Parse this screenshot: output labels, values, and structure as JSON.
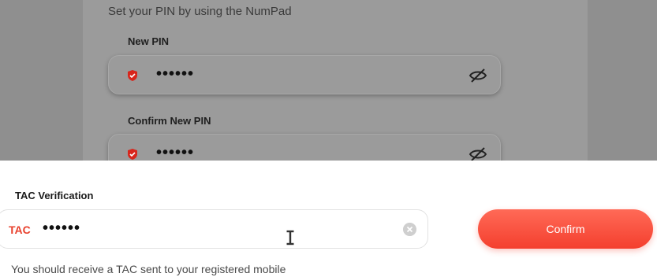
{
  "background": {
    "hint": "Set your PIN by using the NumPad",
    "new_pin": {
      "label": "New PIN",
      "value": "••••••"
    },
    "confirm_pin": {
      "label": "Confirm New PIN",
      "value": "••••••"
    }
  },
  "sheet": {
    "title": "TAC Verification",
    "tac_prefix": "TAC",
    "tac_value": "••••••",
    "confirm_label": "Confirm",
    "note": "You should receive a TAC sent to your registered mobile"
  },
  "colors": {
    "accent": "#f43f2e",
    "shield": "#d8261c"
  },
  "icons": [
    "shield-icon",
    "eye-off-icon",
    "clear-icon",
    "text-cursor-icon"
  ]
}
